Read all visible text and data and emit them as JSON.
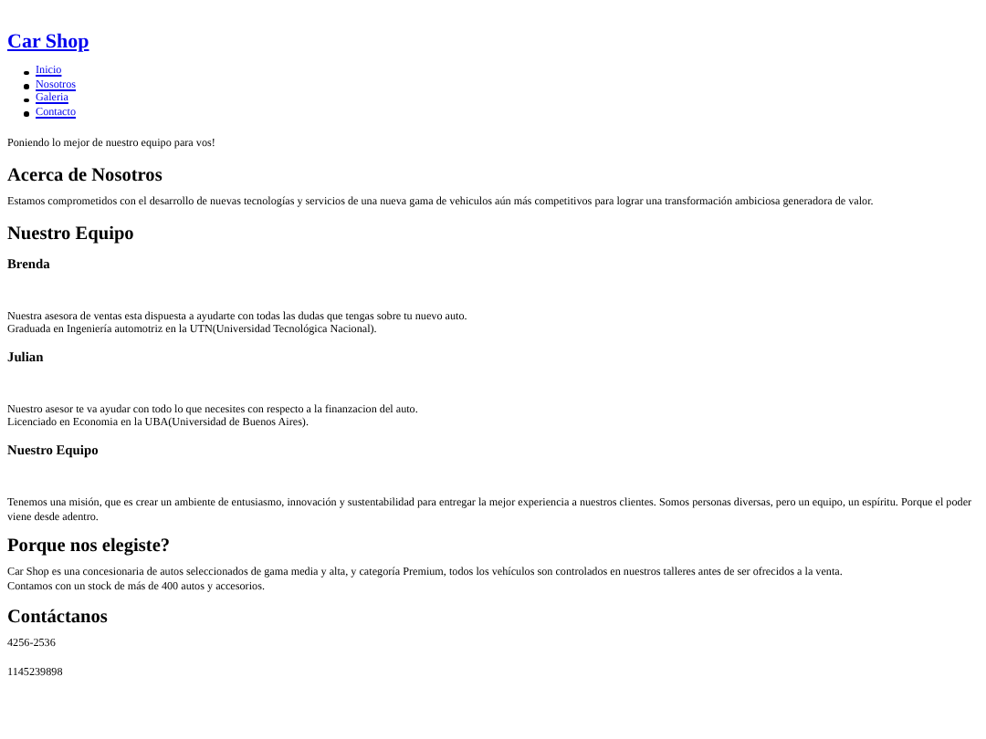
{
  "site_title": "Car Shop",
  "nav": [
    {
      "label": "Inicio"
    },
    {
      "label": "Nosotros"
    },
    {
      "label": "Galeria"
    },
    {
      "label": "Contacto"
    }
  ],
  "tagline": "Poniendo lo mejor de nuestro equipo para vos!",
  "about": {
    "heading": "Acerca de Nosotros",
    "text": "Estamos comprometidos con el desarrollo de nuevas tecnologías y servicios de una nueva gama de vehiculos aún más competitivos para lograr una transformación ambiciosa generadora de valor."
  },
  "team": {
    "heading": "Nuestro Equipo",
    "members": [
      {
        "name": "Brenda",
        "lines": [
          "Nuestra asesora de ventas esta dispuesta a ayudarte con todas las dudas que tengas sobre tu nuevo auto.",
          "Graduada en Ingeniería automotriz en la UTN(Universidad Tecnológica Nacional)."
        ]
      },
      {
        "name": "Julian",
        "lines": [
          "Nuestro asesor te va ayudar con todo lo que necesites con respecto a la finanzacion del auto.",
          "Licenciado en Economia en la UBA(Universidad de Buenos Aires)."
        ]
      },
      {
        "name": "Nuestro Equipo",
        "lines": [
          "Tenemos una misión, que es crear un ambiente de entusiasmo, innovación y sustentabilidad para entregar la mejor experiencia a nuestros clientes. Somos personas diversas, pero un equipo, un espíritu. Porque el poder viene desde adentro."
        ]
      }
    ]
  },
  "why": {
    "heading": "Porque nos elegiste?",
    "lines": [
      "Car Shop es una concesionaria de autos seleccionados de gama media y alta, y categoría Premium, todos los vehículos son controlados en nuestros talleres antes de ser ofrecidos a la venta.",
      "Contamos con un stock de más de 400 autos y accesorios."
    ]
  },
  "contact": {
    "heading": "Contáctanos",
    "phones": [
      "4256-2536",
      "1145239898"
    ]
  }
}
